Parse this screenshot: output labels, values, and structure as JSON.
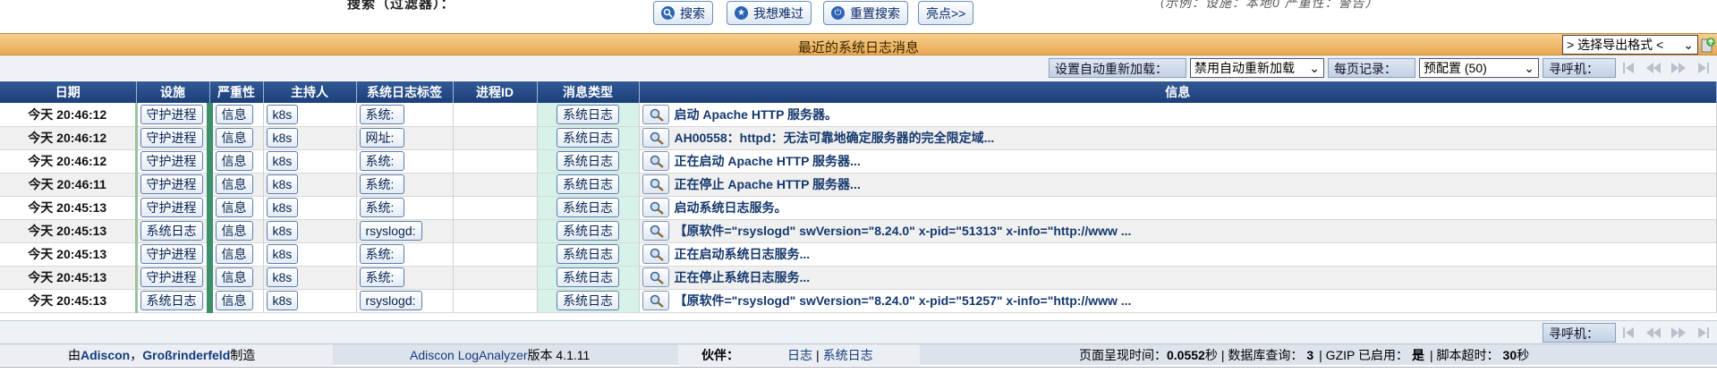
{
  "search": {
    "label": "搜索（过滤器）：",
    "hint": "（示例：设施：本地0 严重性：警告）",
    "buttons": [
      {
        "label": "搜索",
        "icon": "search-icon"
      },
      {
        "label": "我想难过",
        "icon": "star-icon"
      },
      {
        "label": "重置搜索",
        "icon": "power-icon"
      },
      {
        "label": "亮点>>"
      }
    ]
  },
  "titlebar": {
    "title": "最近的系统日志消息",
    "export_select": "> 选择导出格式 <"
  },
  "controls": {
    "auto_reload_label": "设置自动重新加载：",
    "auto_reload_value": "禁用自动重新加载",
    "per_page_label": "每页记录：",
    "per_page_value": "预配置 (50)",
    "pager_label": "寻呼机："
  },
  "table": {
    "columns": [
      "日期",
      "设施",
      "严重性",
      "主持人",
      "系统日志标签",
      "进程ID",
      "消息类型",
      "信息"
    ],
    "rows": [
      {
        "date": "今天 20:46:12",
        "facility": "守护进程",
        "severity": "信息",
        "host": "k8s",
        "tag": "系统:",
        "pid": "",
        "type": "系统日志",
        "message": "启动 Apache HTTP 服务器。"
      },
      {
        "date": "今天 20:46:12",
        "facility": "守护进程",
        "severity": "信息",
        "host": "k8s",
        "tag": "网址:",
        "pid": "",
        "type": "系统日志",
        "message": "AH00558：httpd：无法可靠地确定服务器的完全限定域..."
      },
      {
        "date": "今天 20:46:12",
        "facility": "守护进程",
        "severity": "信息",
        "host": "k8s",
        "tag": "系统:",
        "pid": "",
        "type": "系统日志",
        "message": "正在启动 Apache HTTP 服务器..."
      },
      {
        "date": "今天 20:46:11",
        "facility": "守护进程",
        "severity": "信息",
        "host": "k8s",
        "tag": "系统:",
        "pid": "",
        "type": "系统日志",
        "message": "正在停止 Apache HTTP 服务器..."
      },
      {
        "date": "今天 20:45:13",
        "facility": "守护进程",
        "severity": "信息",
        "host": "k8s",
        "tag": "系统:",
        "pid": "",
        "type": "系统日志",
        "message": "启动系统日志服务。"
      },
      {
        "date": "今天 20:45:13",
        "facility": "系统日志",
        "severity": "信息",
        "host": "k8s",
        "tag": "rsyslogd:",
        "pid": "",
        "type": "系统日志",
        "message": "【原软件=\"rsyslogd\" swVersion=\"8.24.0\" x-pid=\"51313\" x-info=\"http://www ..."
      },
      {
        "date": "今天 20:45:13",
        "facility": "守护进程",
        "severity": "信息",
        "host": "k8s",
        "tag": "系统:",
        "pid": "",
        "type": "系统日志",
        "message": "正在启动系统日志服务..."
      },
      {
        "date": "今天 20:45:13",
        "facility": "守护进程",
        "severity": "信息",
        "host": "k8s",
        "tag": "系统:",
        "pid": "",
        "type": "系统日志",
        "message": "正在停止系统日志服务..."
      },
      {
        "date": "今天 20:45:13",
        "facility": "系统日志",
        "severity": "信息",
        "host": "k8s",
        "tag": "rsyslogd:",
        "pid": "",
        "type": "系统日志",
        "message": "【原软件=\"rsyslogd\" swVersion=\"8.24.0\" x-pid=\"51257\" x-info=\"http://www ..."
      }
    ]
  },
  "footer": {
    "made_by_prefix": "由",
    "made_by_link1": "Adiscon",
    "made_by_sep": "，",
    "made_by_link2": "Großrinderfeld",
    "made_by_suffix": "制造",
    "product_link": "Adiscon LogAnalyzer",
    "version_text": "版本 4.1.11",
    "partners_label": "伙伴：",
    "partner1": "日志",
    "partner_sep": "|",
    "partner2": "系统日志",
    "render_label": "页面呈现时间：",
    "render_value": "0.0552",
    "render_unit": "秒",
    "db_label": "| 数据库查询：",
    "db_value": "3",
    "gzip_label": "| GZIP 已启用：",
    "gzip_value": "是",
    "timeout_label": "| 脚本超时：",
    "timeout_value": "30",
    "timeout_unit": "秒"
  }
}
